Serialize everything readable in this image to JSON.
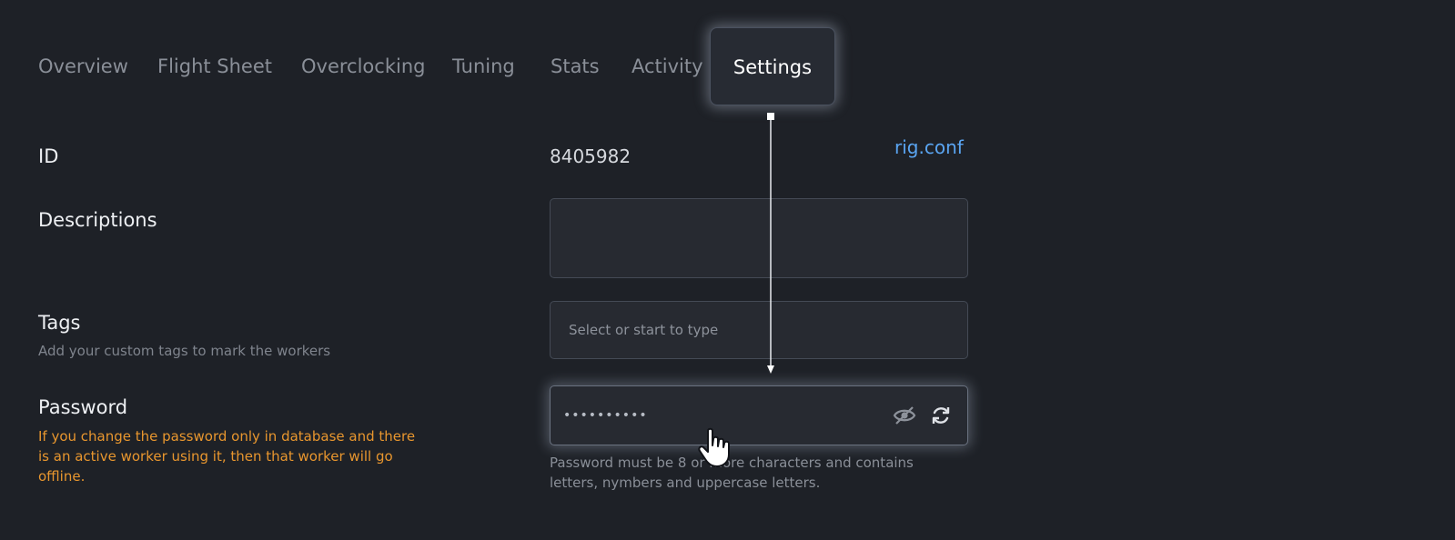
{
  "tabs": [
    {
      "label": "Overview"
    },
    {
      "label": "Flight Sheet"
    },
    {
      "label": "Overclocking"
    },
    {
      "label": "Tuning"
    },
    {
      "label": "Stats"
    },
    {
      "label": "Activity"
    },
    {
      "label": "Settings",
      "active": true
    }
  ],
  "id_row": {
    "label": "ID",
    "value": "8405982",
    "link": "rig.conf"
  },
  "descriptions": {
    "label": "Descriptions",
    "value": ""
  },
  "tags": {
    "label": "Tags",
    "hint": "Add your custom tags to mark the workers",
    "placeholder": "Select or start to type"
  },
  "password": {
    "label": "Password",
    "warning": "If you change the password only in database and there is an active worker using it, then that worker will go offline.",
    "masked_value": "••••••••••",
    "hint": "Password must be 8 or more characters and contains letters, nymbers and uppercase letters."
  },
  "icons": {
    "toggle_visibility": "eye-off-icon",
    "regenerate": "refresh-icon"
  },
  "colors": {
    "background": "#1e2127",
    "link": "#5aa5f2",
    "warning": "#e8962e"
  }
}
